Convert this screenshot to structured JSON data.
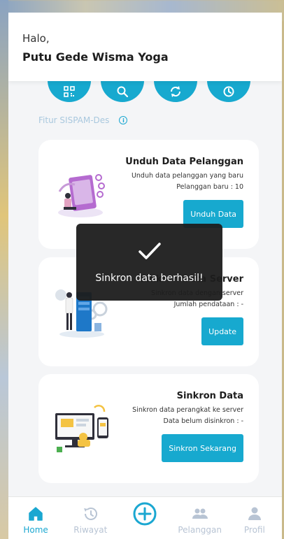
{
  "header": {
    "greeting": "Halo,",
    "username": "Putu Gede Wisma Yoga"
  },
  "quick_actions": [
    {
      "icon": "qr-code-icon"
    },
    {
      "icon": "search-icon"
    },
    {
      "icon": "sync-icon"
    },
    {
      "icon": "clock-icon"
    }
  ],
  "feature_section": {
    "label": "Fitur SISPAM-Des",
    "info_icon": "info-icon"
  },
  "cards": [
    {
      "title": "Unduh Data Pelanggan",
      "desc_line1": "Unduh data pelanggan yang baru",
      "desc_line2": "Pelanggan baru : 10",
      "button": "Unduh Data"
    },
    {
      "title": "Sinkron Data Server",
      "desc_line1": "Sinkron data dengan server",
      "desc_line2": "Jumlah pendataan : -",
      "button": "Update"
    },
    {
      "title": "Sinkron Data",
      "desc_line1": "Sinkron data perangkat ke server",
      "desc_line2": "Data belum disinkron : -",
      "button": "Sinkron Sekarang"
    }
  ],
  "toast": {
    "message": "Sinkron data berhasil!",
    "icon": "checkmark-icon"
  },
  "nav": {
    "home": "Home",
    "history": "Riwayat",
    "customers": "Pelanggan",
    "profile": "Profil",
    "add_icon": "add-circle-icon"
  },
  "colors": {
    "primary": "#17a9cf",
    "nav_inactive": "#b8c4d4",
    "toast_bg": "#1c1c1c"
  }
}
